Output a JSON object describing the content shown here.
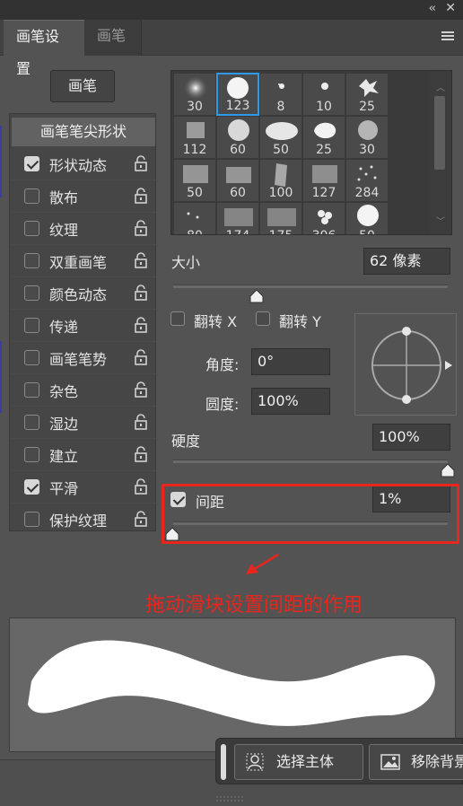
{
  "panel": {
    "tabs": [
      {
        "label": "画笔设置",
        "active": true
      },
      {
        "label": "画笔",
        "active": false
      }
    ],
    "collapse_icon": "double-chevron-left",
    "close_icon": "close-x",
    "menu_icon": "hamburger-menu"
  },
  "brush_button": {
    "label": "画笔"
  },
  "options": {
    "header": "画笔笔尖形状",
    "items": [
      {
        "label": "形状动态",
        "checked": true
      },
      {
        "label": "散布",
        "checked": false
      },
      {
        "label": "纹理",
        "checked": false
      },
      {
        "label": "双重画笔",
        "checked": false
      },
      {
        "label": "颜色动态",
        "checked": false
      },
      {
        "label": "传递",
        "checked": false
      },
      {
        "label": "画笔笔势",
        "checked": false
      },
      {
        "label": "杂色",
        "checked": false
      },
      {
        "label": "湿边",
        "checked": false
      },
      {
        "label": "建立",
        "checked": false
      },
      {
        "label": "平滑",
        "checked": true
      },
      {
        "label": "保护纹理",
        "checked": false
      }
    ]
  },
  "presets": [
    {
      "size": "30",
      "selected": false
    },
    {
      "size": "123",
      "selected": true
    },
    {
      "size": "8",
      "selected": false
    },
    {
      "size": "10",
      "selected": false
    },
    {
      "size": "25",
      "selected": false
    },
    {
      "size": "112",
      "selected": false
    },
    {
      "size": "60",
      "selected": false
    },
    {
      "size": "50",
      "selected": false
    },
    {
      "size": "25",
      "selected": false
    },
    {
      "size": "30",
      "selected": false
    },
    {
      "size": "50",
      "selected": false
    },
    {
      "size": "60",
      "selected": false
    },
    {
      "size": "100",
      "selected": false
    },
    {
      "size": "127",
      "selected": false
    },
    {
      "size": "284",
      "selected": false
    },
    {
      "size": "80",
      "selected": false
    },
    {
      "size": "174",
      "selected": false
    },
    {
      "size": "175",
      "selected": false
    },
    {
      "size": "306",
      "selected": false
    },
    {
      "size": "50",
      "selected": false
    }
  ],
  "size": {
    "label": "大小",
    "value": "62 像素",
    "slider_fraction": 0.2
  },
  "flip_x": {
    "label": "翻转 X",
    "checked": false
  },
  "flip_y": {
    "label": "翻转 Y",
    "checked": false
  },
  "angle": {
    "label": "角度:",
    "value": "0°"
  },
  "roundness": {
    "label": "圆度:",
    "value": "100%"
  },
  "hardness": {
    "label": "硬度",
    "value": "100%",
    "slider_fraction": 1.0
  },
  "spacing": {
    "label": "间距",
    "value": "1%",
    "checked": true,
    "slider_fraction": 0.0
  },
  "annotation": {
    "text": "拖动滑块设置间距的作用",
    "color": "#e8261e"
  },
  "actions": {
    "select_subject": "选择主体",
    "remove_background": "移除背景"
  },
  "colors": {
    "accent": "#2d9ae8",
    "highlight": "#e8261e",
    "panel_bg": "#535353"
  }
}
